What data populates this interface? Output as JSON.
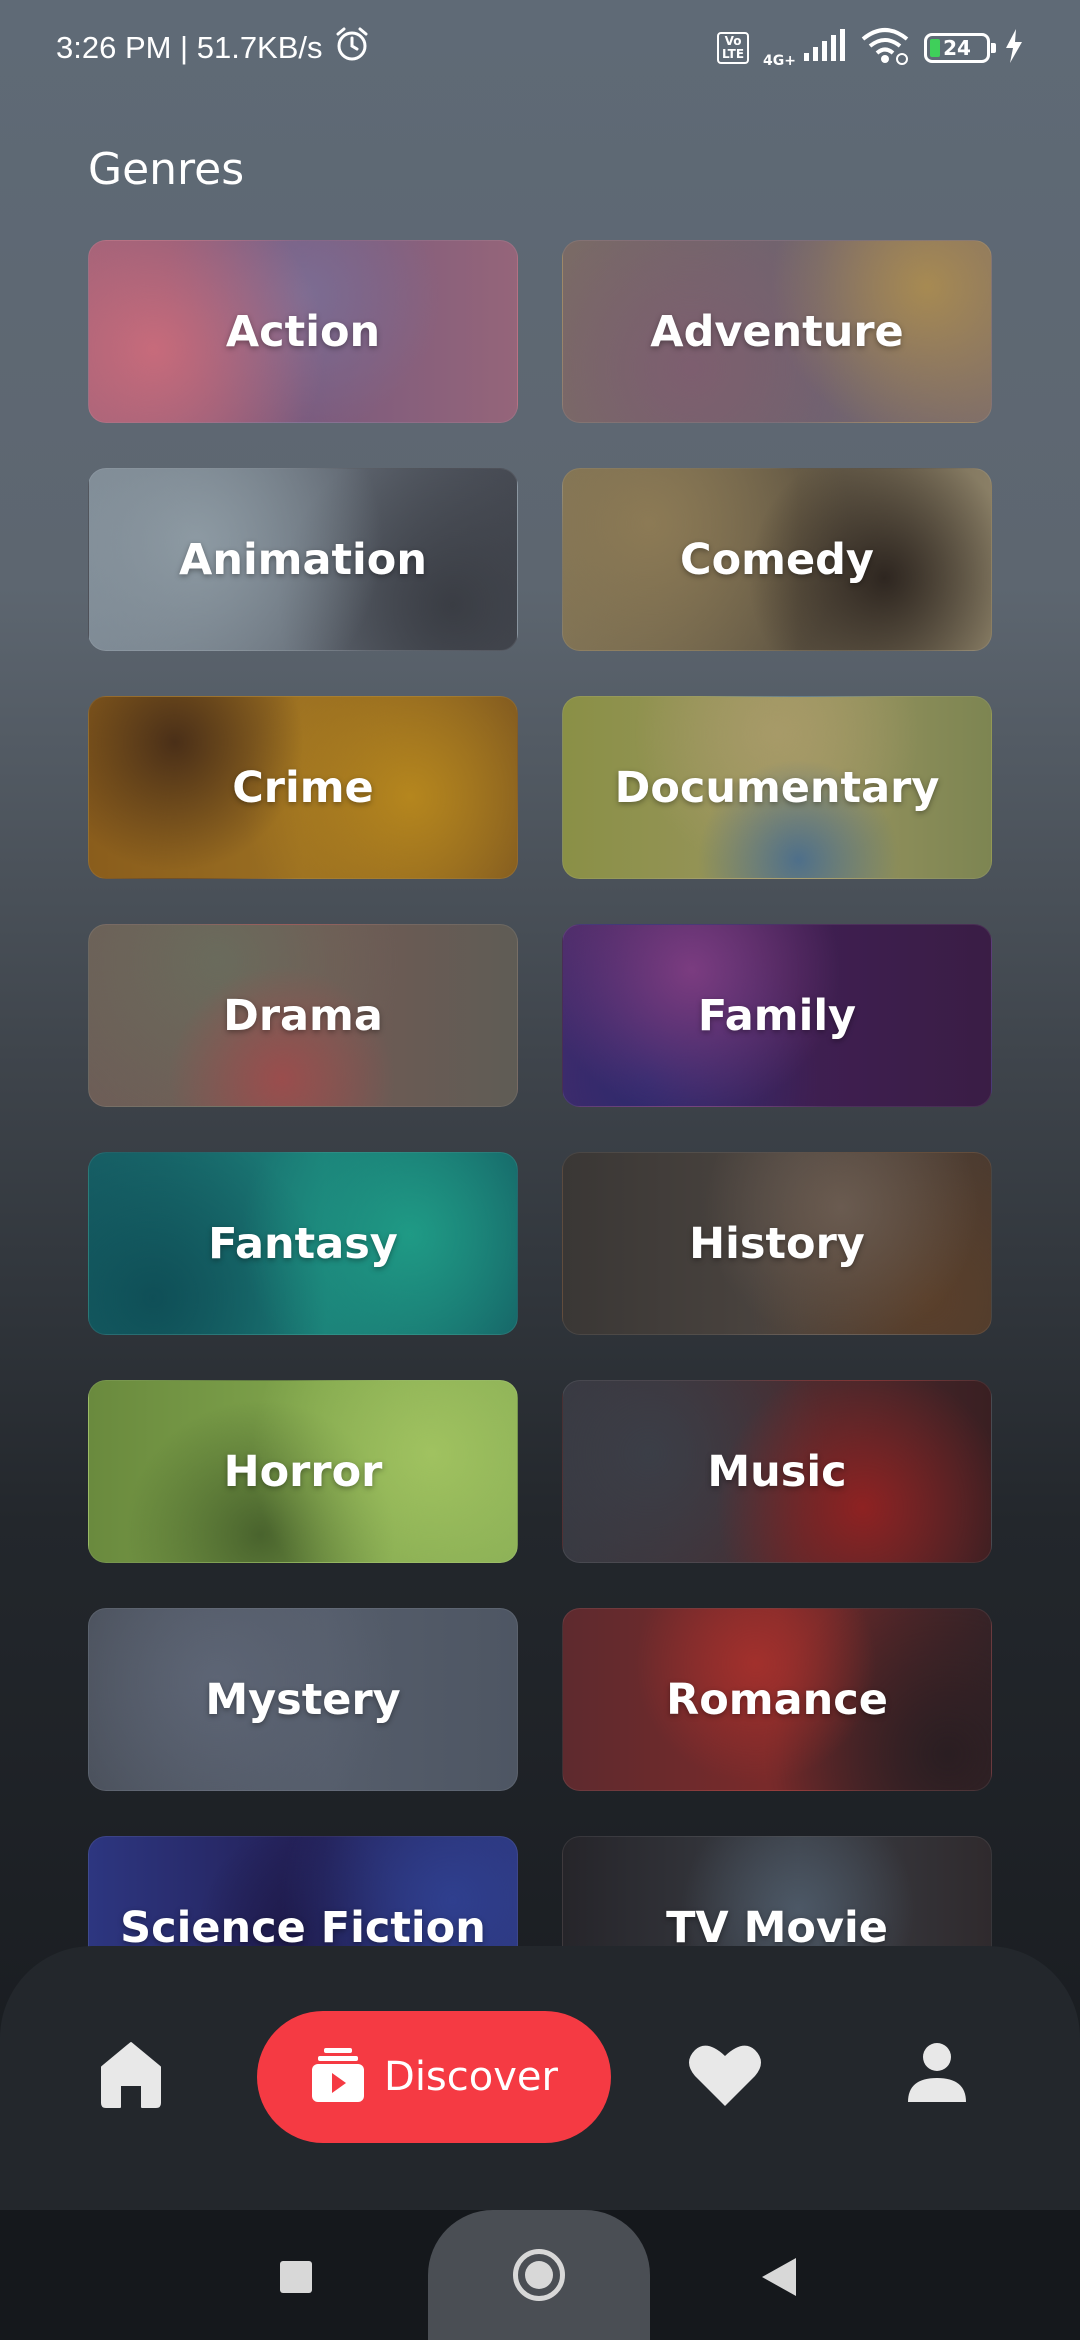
{
  "status_bar": {
    "time_speed": "3:26 PM | 51.7KB/s",
    "volte": "Vo\nLTE",
    "network": "4G+",
    "battery": "24"
  },
  "section_title": "Genres",
  "genres": [
    {
      "label": "Action"
    },
    {
      "label": "Adventure"
    },
    {
      "label": "Animation"
    },
    {
      "label": "Comedy"
    },
    {
      "label": "Crime"
    },
    {
      "label": "Documentary"
    },
    {
      "label": "Drama"
    },
    {
      "label": "Family"
    },
    {
      "label": "Fantasy"
    },
    {
      "label": "History"
    },
    {
      "label": "Horror"
    },
    {
      "label": "Music"
    },
    {
      "label": "Mystery"
    },
    {
      "label": "Romance"
    },
    {
      "label": "Science Fiction"
    },
    {
      "label": "TV Movie"
    }
  ],
  "bottom_nav": {
    "discover_label": "Discover",
    "active_color": "#f53a43"
  },
  "icons": {
    "alarm": "alarm-icon",
    "signal": "signal-icon",
    "wifi": "wifi-icon",
    "charging": "charging-bolt-icon",
    "home": "home-icon",
    "discover": "discover-icon",
    "favorites": "heart-icon",
    "profile": "profile-icon"
  }
}
